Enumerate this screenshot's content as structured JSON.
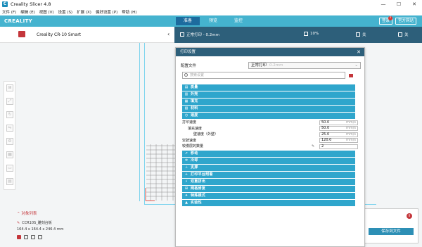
{
  "window": {
    "title": "Creality Slicer 4.8",
    "minimize": "—",
    "maximize": "☐",
    "close": "✕"
  },
  "menu": [
    "文件 (F)",
    "编辑 (E)",
    "视图 (V)",
    "设置 (S)",
    "扩展 (X)",
    "偏好设置 (P)",
    "帮助 (H)"
  ],
  "header": {
    "logo": "CREALITY",
    "stages": [
      "准备",
      "预览",
      "监控"
    ],
    "active_stage": 0,
    "btn_login": "登录",
    "btn_web": "官方网站",
    "notification_count": "1"
  },
  "printer": {
    "name": "Creality CR-10 Smart",
    "chevron": "‹"
  },
  "settings_bar": {
    "profile": "正常打印 - 0.2mm",
    "infill": "10%",
    "support": "关",
    "adhesion": "关"
  },
  "print_panel": {
    "title": "打印设置",
    "close": "✕",
    "profile_label": "配置文件",
    "profile_value": "正常打印",
    "profile_muted": "0.2mm",
    "search_placeholder": "搜索设置",
    "categories_top": [
      {
        "icon": "▤",
        "label": "质量"
      },
      {
        "icon": "▥",
        "label": "外壳"
      },
      {
        "icon": "▦",
        "label": "填充"
      },
      {
        "icon": "▧",
        "label": "材料"
      },
      {
        "icon": "◷",
        "label": "速度"
      }
    ],
    "speed_settings": [
      {
        "label": "打印速度",
        "indent": 0,
        "value": "50.0",
        "unit": "mm/s"
      },
      {
        "label": "填充速度",
        "indent": 1,
        "value": "50.0",
        "unit": "mm/s"
      },
      {
        "label": "壁速度（外壁）",
        "indent": 2,
        "value": "25.0",
        "unit": "mm/s"
      },
      {
        "label": "空驶速度",
        "indent": 0,
        "value": "120.0",
        "unit": "mm/s"
      },
      {
        "label": "较慢层的数量",
        "indent": 0,
        "value": "2",
        "unit": ""
      }
    ],
    "categories_bottom": [
      {
        "icon": "➚",
        "label": "移动"
      },
      {
        "icon": "✲",
        "label": "冷却"
      },
      {
        "icon": "⊥",
        "label": "支撑"
      },
      {
        "icon": "+",
        "label": "打印平台附着"
      },
      {
        "icon": "⚡",
        "label": "双重挤出"
      },
      {
        "icon": "⊞",
        "label": "网格修复"
      },
      {
        "icon": "✦",
        "label": "特殊模式"
      },
      {
        "icon": "▲",
        "label": "实验性"
      }
    ]
  },
  "object_list": {
    "title": "⌃ 对象列表",
    "file": "CCR10S_雕刻台板",
    "dims": "164.4 x 164.4 x 246.4 mm"
  },
  "save": {
    "info": "i",
    "button": "保存到文件"
  },
  "colors": {
    "accent": "#45b3cf",
    "dark": "#2d5f7a",
    "category": "#2fa6cc",
    "brand_red": "#c4363b"
  }
}
